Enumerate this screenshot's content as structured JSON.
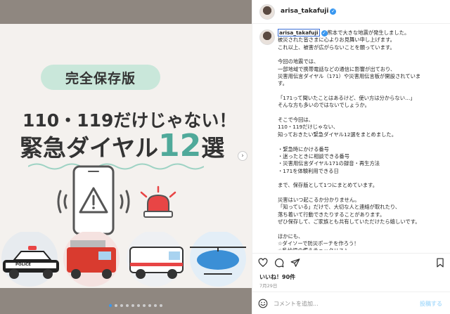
{
  "post_image": {
    "badge": "完全保存版",
    "line1": "110・119だけじゃない！",
    "line2_prefix": "緊急ダイヤル",
    "line2_number": "12",
    "line2_suffix": "選",
    "police_car_text": "POLICE",
    "colors": {
      "badge_bg": "#c9e7da",
      "accent": "#4fa99a",
      "dot_active": "#3897f0"
    }
  },
  "header": {
    "username": "arisa_takafuji",
    "verified_icon": "verified-badge-icon"
  },
  "caption": {
    "username": "arisa_takafuji",
    "lines": [
      "熊本で大きな地震が発生しました。",
      "被災された皆さまに心よりお見舞い申し上げます。",
      "これ以上、被害が広がらないことを願っています。",
      "",
      "今回の地震では、",
      "一部地域で携帯電話などの通信に影響が出ており、",
      "災害用伝言ダイヤル（171）や災害用伝言板が開設されていま",
      "す。",
      "",
      "「171って聞いたことはあるけど、使い方は分からない…」",
      "そんな方も多いのではないでしょうか。",
      "",
      "そこで今回は、",
      "110・119だけじゃない、",
      "知っておきたい緊急ダイヤル12選をまとめました。",
      "",
      "・緊急時にかける番号",
      "・迷ったときに相談できる番号",
      "・災害用伝言ダイヤル171の録音・再生方法",
      "・171を体験利用できる日",
      "",
      "まで、保存版として1つにまとめています。",
      "",
      "災害はいつ起こるか分かりません。",
      "「知っている」だけで、大切な人と連絡が取れたり、",
      "落ち着いて行動できたりすることがあります。",
      "ぜひ保存して、ご家族とも共有していただけたら嬉しいです。",
      "",
      "ほかにも、",
      "☆ダイソーで防災ポーチを作ろう！",
      "☆乳幼児の備えチェックリスト"
    ]
  },
  "actions": {
    "icons": [
      "heart-icon",
      "comment-icon",
      "share-icon",
      "bookmark-icon"
    ]
  },
  "likes_text": "いいね！90件",
  "date_text": "7月29日",
  "comment": {
    "placeholder": "コメントを追加...",
    "post_label": "投稿する"
  }
}
